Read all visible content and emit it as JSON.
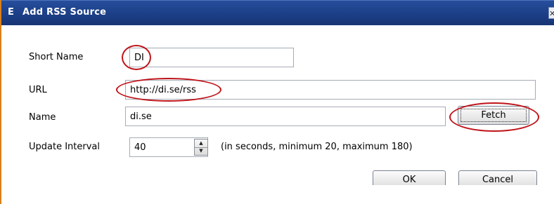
{
  "window": {
    "app_icon": "E",
    "title": "Add RSS Source",
    "close_glyph": "✕"
  },
  "form": {
    "short_name": {
      "label": "Short Name",
      "value": "DI"
    },
    "url": {
      "label": "URL",
      "value": "http://di.se/rss"
    },
    "name": {
      "label": "Name",
      "value": "di.se"
    },
    "update_interval": {
      "label": "Update Interval",
      "value": "40",
      "hint": "(in seconds, minimum 20, maximum 180)"
    }
  },
  "buttons": {
    "fetch": "Fetch",
    "ok": "OK",
    "cancel": "Cancel"
  },
  "colors": {
    "titlebar": "#1c3f87",
    "highlight": "#c0131a",
    "accent_border": "#d9801b"
  },
  "icons": {
    "spin_up": "▲",
    "spin_down": "▼"
  }
}
